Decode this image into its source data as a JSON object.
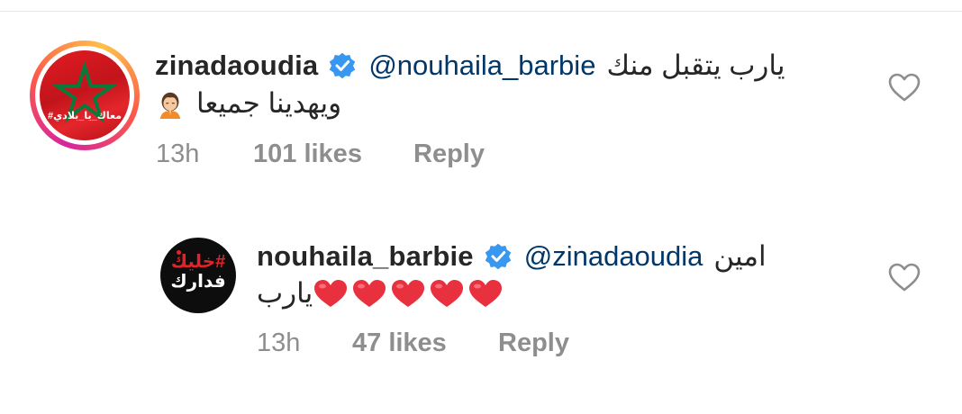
{
  "comments": [
    {
      "username": "zinadaoudia",
      "verified": true,
      "mention": "@nouhaila_barbie",
      "text_line1": "يارب يتقبل منك",
      "text_line2": "ويهدينا جميعا",
      "line2_emoji": "person-praying-emoji",
      "avatar_caption": "#معاك_يا_بلادي",
      "time": "13h",
      "likes": "101 likes",
      "reply_label": "Reply",
      "like_icon": "heart-outline-icon"
    },
    {
      "username": "nouhaila_barbie",
      "verified": true,
      "mention": "@zinadaoudia",
      "text_line1": "امين",
      "text_line2": "يارب",
      "line2_emoji": "red-heart-emoji",
      "heart_count": 5,
      "avatar_logo_top": "#خليك",
      "avatar_logo_bottom": "فدارك",
      "time": "13h",
      "likes": "47 likes",
      "reply_label": "Reply",
      "like_icon": "heart-outline-icon"
    }
  ],
  "colors": {
    "username": "#262626",
    "mention": "#00376b",
    "meta": "#8e8e8e",
    "verified": "#3897f0",
    "heart_emoji": "#e8303e"
  }
}
